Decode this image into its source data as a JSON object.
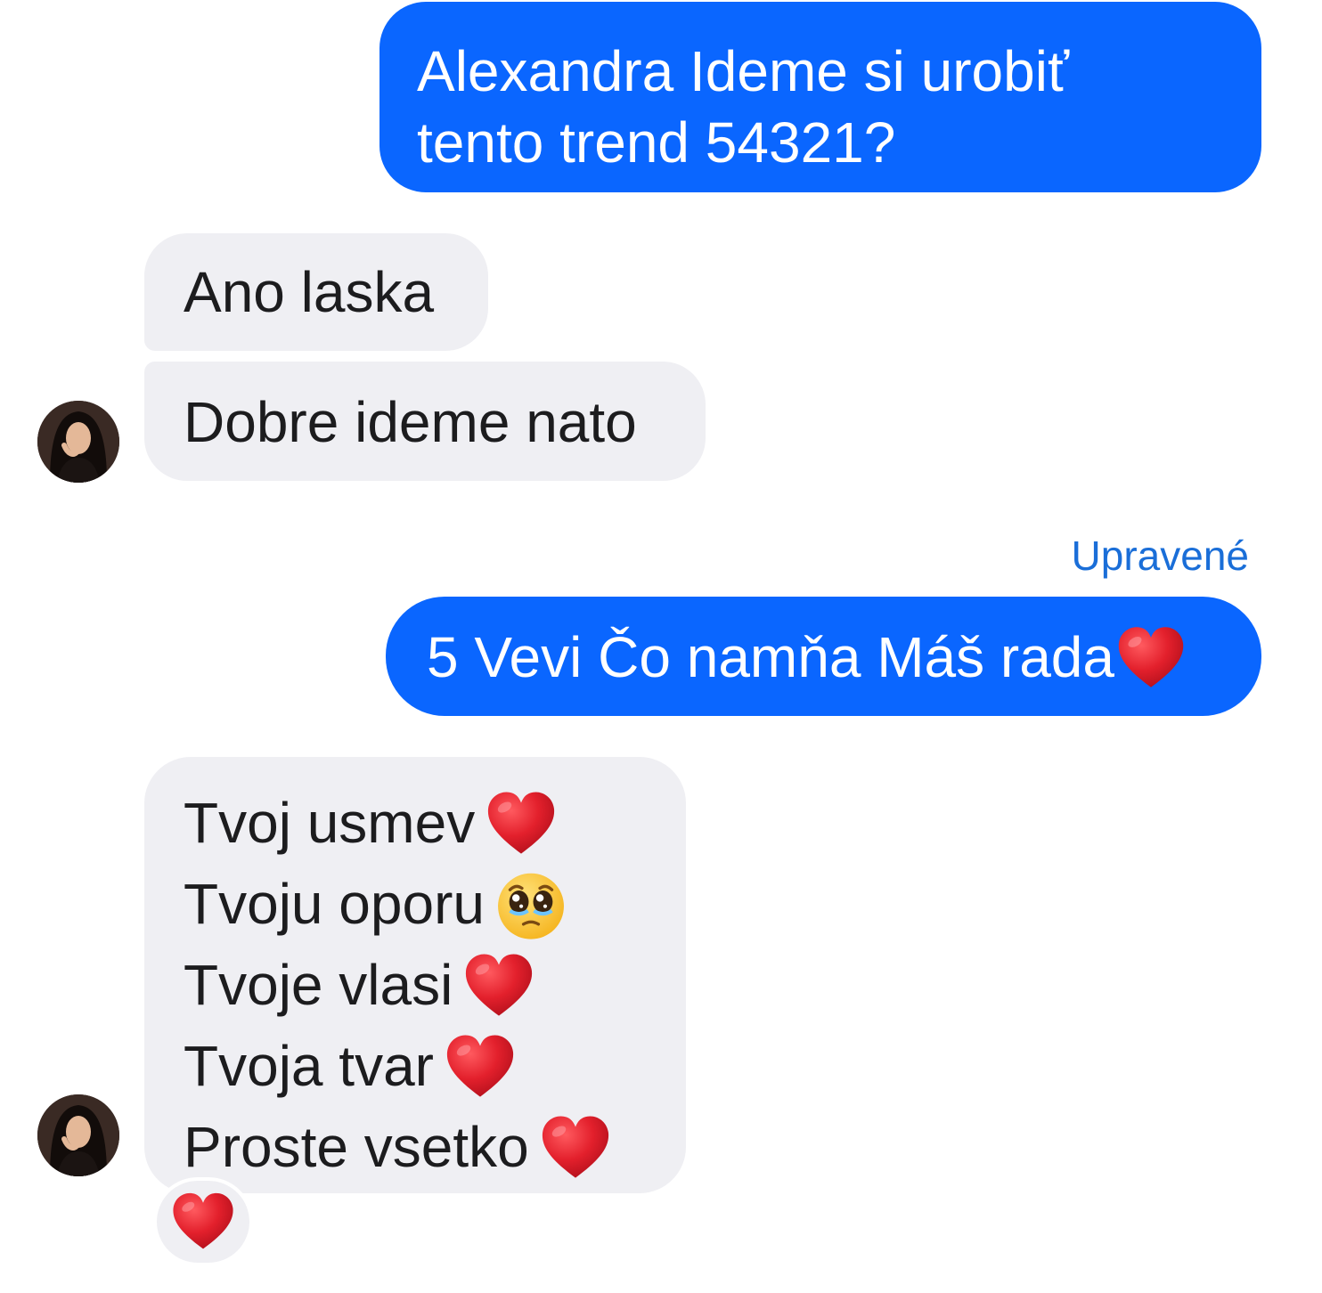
{
  "messages": [
    {
      "direction": "outgoing",
      "lines": [
        "Alexandra Ideme si urobiť",
        "tento trend 54321?"
      ]
    },
    {
      "direction": "incoming",
      "text": "Ano laska"
    },
    {
      "direction": "incoming",
      "text": "Dobre ideme nato"
    },
    {
      "direction": "outgoing",
      "edited_label": "Upravené",
      "text": "5 Vevi Čo namňa Máš rada",
      "emoji": "red-heart-icon"
    },
    {
      "direction": "incoming",
      "lines": [
        {
          "text": "Tvoj usmev",
          "emoji": "red-heart-icon"
        },
        {
          "text": "Tvoju oporu",
          "emoji": "pleading-face-icon"
        },
        {
          "text": "Tvoje vlasi",
          "emoji": "red-heart-icon"
        },
        {
          "text": "Tvoja tvar",
          "emoji": "red-heart-icon"
        },
        {
          "text": "Proste vsetko",
          "emoji": "red-heart-icon"
        }
      ],
      "reaction": "red-heart-icon"
    }
  ],
  "colors": {
    "outgoing_bubble": "#0a66ff",
    "incoming_bubble": "#efeff3",
    "edited_label": "#1a6ed8",
    "heart": "#e0202e"
  }
}
